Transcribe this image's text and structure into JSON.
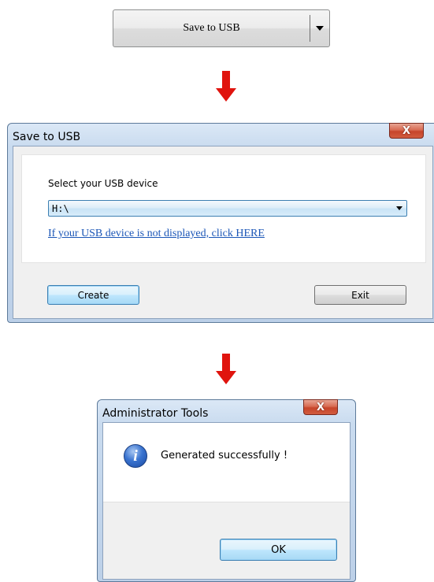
{
  "split_button": {
    "label": "Save to USB",
    "dropdown_icon": "chevron-down-icon"
  },
  "arrows": {
    "icon": "red-down-arrow",
    "color": "#e0140e"
  },
  "save_dialog": {
    "title": "Save to USB",
    "close_label": "X",
    "device_label": "Select your USB device",
    "device_value": "H:\\",
    "help_link": "If your USB device is not displayed, click HERE",
    "create_label": "Create",
    "exit_label": "Exit"
  },
  "admin_dialog": {
    "title": "Administrator Tools",
    "close_label": "X",
    "icon": "info-icon",
    "icon_glyph": "i",
    "message": "Generated successfully !",
    "ok_label": "OK"
  }
}
